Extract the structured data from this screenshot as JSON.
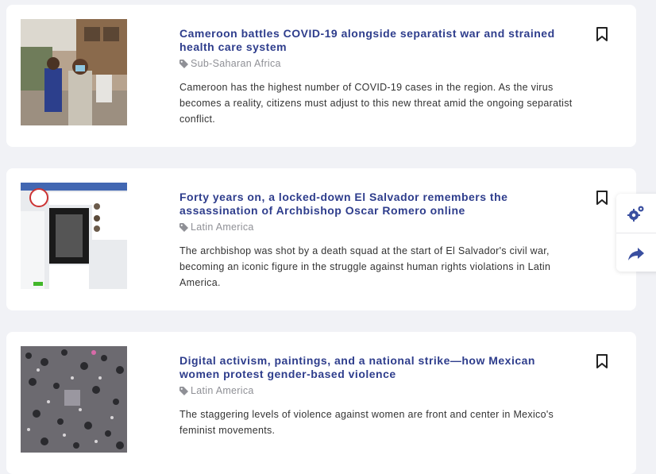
{
  "articles": [
    {
      "title": "Cameroon battles COVID-19 alongside separatist war and strained health care system",
      "region": "Sub-Saharan Africa",
      "summary": "Cameroon has the highest number of COVID-19 cases in the region. As the virus becomes a reality, citizens must adjust to this new threat amid the ongoing separatist conflict.",
      "bookmark_icon": "bookmark-icon"
    },
    {
      "title": "Forty years on, a locked-down El Salvador remembers the assassination of Archbishop Oscar Romero online",
      "region": "Latin America",
      "summary": "The archbishop was shot by a death squad at the start of El Salvador's civil war, becoming an iconic figure in the struggle against human rights violations in Latin America.",
      "bookmark_icon": "bookmark-icon"
    },
    {
      "title": "Digital activism, paintings, and a national strike—how Mexican women protest gender-based violence",
      "region": "Latin America",
      "summary": "The staggering levels of violence against women are front and center in Mexico's feminist movements.",
      "bookmark_icon": "bookmark-icon"
    }
  ],
  "side_panel": {
    "buttons": [
      {
        "icon": "settings-gears-icon"
      },
      {
        "icon": "share-arrow-icon"
      }
    ]
  },
  "colors": {
    "title": "#2e3d8c",
    "region": "#8f9096",
    "accent_icon": "#3a4fa0",
    "background": "#f1f2f6"
  }
}
